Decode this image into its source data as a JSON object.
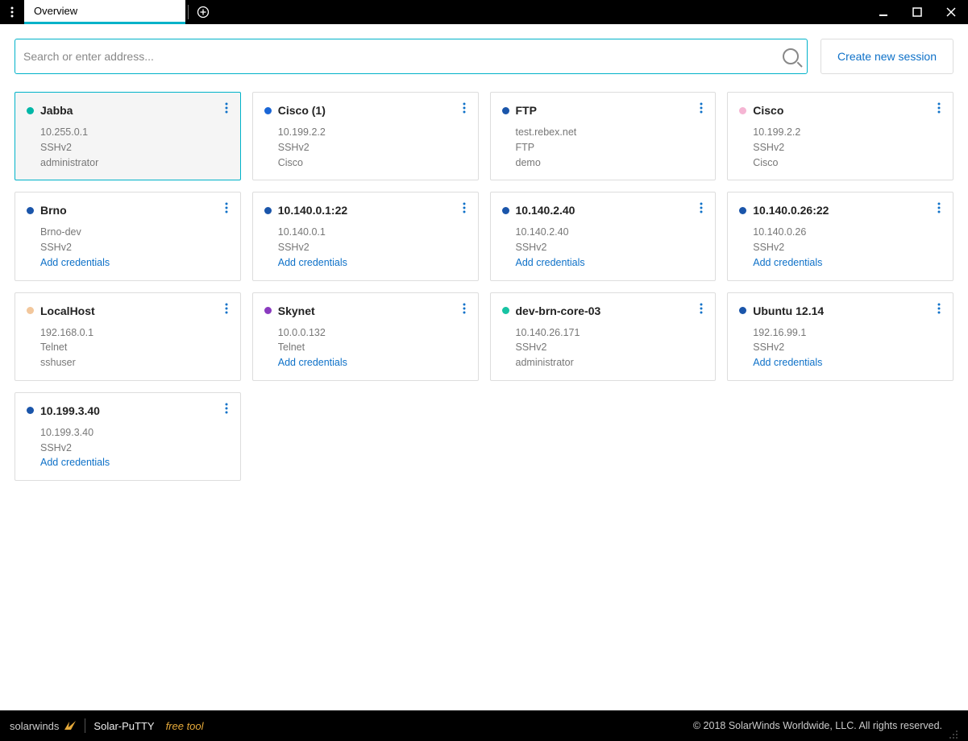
{
  "titlebar": {
    "tab_label": "Overview"
  },
  "search": {
    "placeholder": "Search or enter address..."
  },
  "create_button": "Create new session",
  "add_credentials_label": "Add credentials",
  "colors": {
    "teal": "#00b7a7",
    "blue": "#1a66d6",
    "navy": "#1a55aa",
    "pink": "#f5b5d3",
    "peach": "#f2c79c",
    "purple": "#8a3bbf",
    "teal2": "#17c3a3"
  },
  "sessions": [
    {
      "name": "Jabba",
      "host": "10.255.0.1",
      "protocol": "SSHv2",
      "user": "administrator",
      "color": "teal",
      "needs_creds": false,
      "active": true
    },
    {
      "name": "Cisco (1)",
      "host": "10.199.2.2",
      "protocol": "SSHv2",
      "user": "Cisco",
      "color": "blue",
      "needs_creds": false,
      "active": false
    },
    {
      "name": "FTP",
      "host": "test.rebex.net",
      "protocol": "FTP",
      "user": "demo",
      "color": "navy",
      "needs_creds": false,
      "active": false
    },
    {
      "name": "Cisco",
      "host": "10.199.2.2",
      "protocol": "SSHv2",
      "user": "Cisco",
      "color": "pink",
      "needs_creds": false,
      "active": false
    },
    {
      "name": "Brno",
      "host": "Brno-dev",
      "protocol": "SSHv2",
      "user": "",
      "color": "navy",
      "needs_creds": true,
      "active": false
    },
    {
      "name": "10.140.0.1:22",
      "host": "10.140.0.1",
      "protocol": "SSHv2",
      "user": "",
      "color": "navy",
      "needs_creds": true,
      "active": false
    },
    {
      "name": "10.140.2.40",
      "host": "10.140.2.40",
      "protocol": "SSHv2",
      "user": "",
      "color": "navy",
      "needs_creds": true,
      "active": false
    },
    {
      "name": "10.140.0.26:22",
      "host": "10.140.0.26",
      "protocol": "SSHv2",
      "user": "",
      "color": "navy",
      "needs_creds": true,
      "active": false
    },
    {
      "name": "LocalHost",
      "host": "192.168.0.1",
      "protocol": "Telnet",
      "user": "sshuser",
      "color": "peach",
      "needs_creds": false,
      "active": false
    },
    {
      "name": "Skynet",
      "host": "10.0.0.132",
      "protocol": "Telnet",
      "user": "",
      "color": "purple",
      "needs_creds": true,
      "active": false
    },
    {
      "name": "dev-brn-core-03",
      "host": "10.140.26.171",
      "protocol": "SSHv2",
      "user": "administrator",
      "color": "teal2",
      "needs_creds": false,
      "active": false
    },
    {
      "name": "Ubuntu 12.14",
      "host": "192.16.99.1",
      "protocol": "SSHv2",
      "user": "",
      "color": "navy",
      "needs_creds": true,
      "active": false
    },
    {
      "name": "10.199.3.40",
      "host": "10.199.3.40",
      "protocol": "SSHv2",
      "user": "",
      "color": "navy",
      "needs_creds": true,
      "active": false
    }
  ],
  "footer": {
    "brand": "solarwinds",
    "app": "Solar-PuTTY",
    "tag": "free tool",
    "copyright": "© 2018 SolarWinds Worldwide, LLC. All rights reserved."
  }
}
